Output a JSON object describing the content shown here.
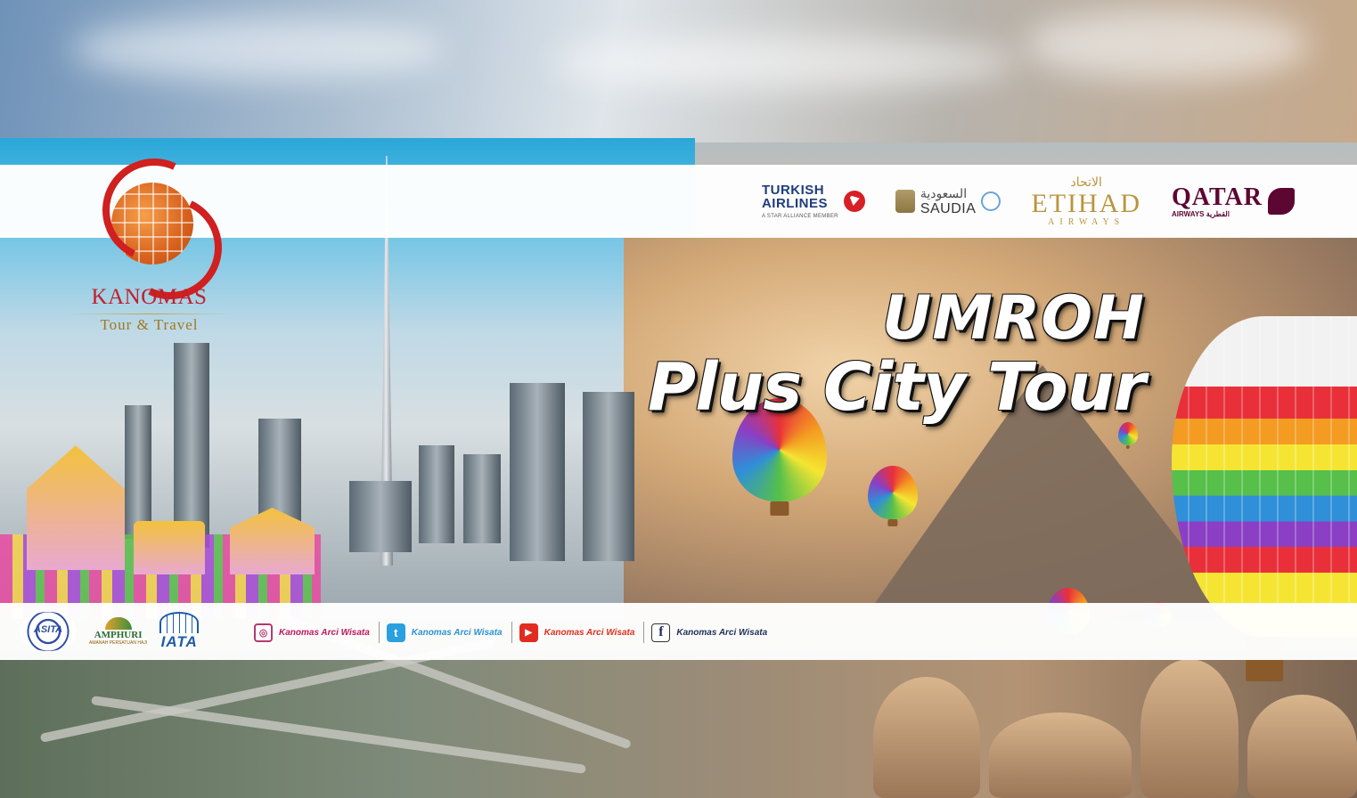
{
  "brand": {
    "name": "KANOMAS",
    "tagline": "Tour & Travel"
  },
  "airlines": {
    "turkish": {
      "line1": "TURKISH",
      "line2": "AIRLINES",
      "sub": "A STAR ALLIANCE MEMBER"
    },
    "saudia": {
      "arabic": "السعودية",
      "name": "SAUDIA"
    },
    "etihad": {
      "arabic": "الاتحاد",
      "name": "ETIHAD",
      "sub": "AIRWAYS"
    },
    "qatar": {
      "name": "QATAR",
      "sub": "AIRWAYS القطرية"
    }
  },
  "headline": {
    "line1": "UMROH",
    "line2": "Plus City Tour"
  },
  "associations": {
    "asita": "ASITA",
    "amphuri": "AMPHURI",
    "amphuri_sub": "AMANAH PERSATUAN HAJI",
    "iata": "IATA"
  },
  "socials": [
    {
      "icon": "instagram-icon",
      "glyph": "◎",
      "handle": "Kanomas Arci Wisata",
      "color": "#c2185b"
    },
    {
      "icon": "twitter-icon",
      "glyph": "t",
      "handle": "Kanomas Arci Wisata",
      "color": "#2a93d5"
    },
    {
      "icon": "youtube-icon",
      "glyph": "▶",
      "handle": "Kanomas Arci Wisata",
      "color": "#e0301e"
    },
    {
      "icon": "facebook-icon",
      "glyph": "f",
      "handle": "Kanomas Arci Wisata",
      "color": "#1f2f5a"
    }
  ],
  "colors": {
    "brand_red": "#c0202a",
    "brand_gold": "#a2781e",
    "qatar_maroon": "#5c0632",
    "etihad_gold": "#b8953f"
  }
}
